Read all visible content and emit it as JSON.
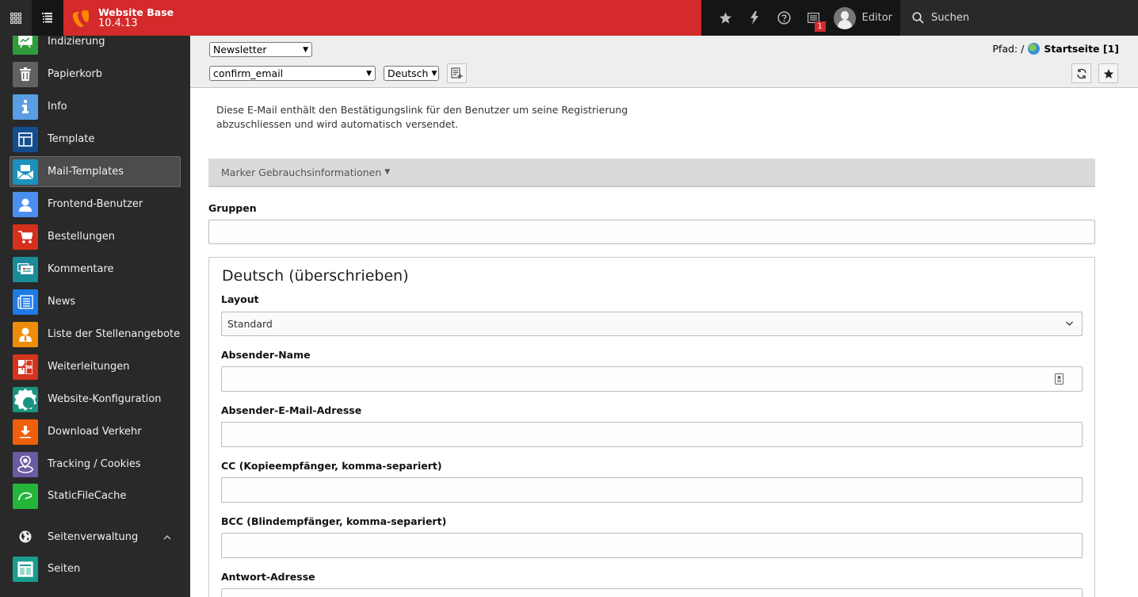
{
  "topbar": {
    "site_name": "Website Base",
    "version": "10.4.13",
    "notification_count": "1",
    "user_name": "Editor",
    "search_label": "Suchen",
    "brand_color": "#d42a2b"
  },
  "sidebar": {
    "items": [
      {
        "label": "Indizierung",
        "icon": "indexing-icon",
        "color": "#2f9c3b"
      },
      {
        "label": "Papierkorb",
        "icon": "trash-icon",
        "color": "#616161"
      },
      {
        "label": "Info",
        "icon": "info-icon",
        "color": "#5a9de4"
      },
      {
        "label": "Template",
        "icon": "template-icon",
        "color": "#134d8c"
      },
      {
        "label": "Mail-Templates",
        "icon": "mail-template-icon",
        "color": "#1c91bd",
        "active": true
      },
      {
        "label": "Frontend-Benutzer",
        "icon": "frontend-user-icon",
        "color": "#4a8ef0"
      },
      {
        "label": "Bestellungen",
        "icon": "cart-icon",
        "color": "#d5301c"
      },
      {
        "label": "Kommentare",
        "icon": "comments-icon",
        "color": "#1a8c9a"
      },
      {
        "label": "News",
        "icon": "news-icon",
        "color": "#1e7ae6"
      },
      {
        "label": "Liste der Stellenangebote",
        "icon": "jobs-icon",
        "color": "#f08c0b"
      },
      {
        "label": "Weiterleitungen",
        "icon": "redirect-icon",
        "color": "#d4341d"
      },
      {
        "label": "Website-Konfiguration",
        "icon": "site-config-icon",
        "color": "#1a9480"
      },
      {
        "label": "Download Verkehr",
        "icon": "download-icon",
        "color": "#f05f0c"
      },
      {
        "label": "Tracking / Cookies",
        "icon": "location-icon",
        "color": "#6b5ba2"
      },
      {
        "label": "StaticFileCache",
        "icon": "speedometer-icon",
        "color": "#26b53b"
      }
    ],
    "section": {
      "label": "Seitenverwaltung"
    },
    "section_items": [
      {
        "label": "Seiten",
        "icon": "pages-icon",
        "color": "#1a9c8f"
      }
    ]
  },
  "docheader": {
    "category_select": "Newsletter",
    "template_select": "confirm_email",
    "language_select": "Deutsch",
    "path_label": "Pfad: /",
    "path_page": "Startseite [1]"
  },
  "content": {
    "description": "Diese E-Mail enthält den Bestätigungslink für den Benutzer um seine Registrierung abzuschliessen und wird automatisch versendet.",
    "marker_info": "Marker Gebrauchsinformationen",
    "groups_label": "Gruppen",
    "groups_value": "",
    "panel": {
      "title": "Deutsch (überschrieben)",
      "layout_label": "Layout",
      "layout_value": "Standard",
      "sender_name_label": "Absender-Name",
      "sender_email_label": "Absender-E-Mail-Adresse",
      "cc_label": "CC (Kopieempfänger, komma-separiert)",
      "bcc_label": "BCC (Blindempfänger, komma-separiert)",
      "reply_label": "Antwort-Adresse"
    }
  }
}
